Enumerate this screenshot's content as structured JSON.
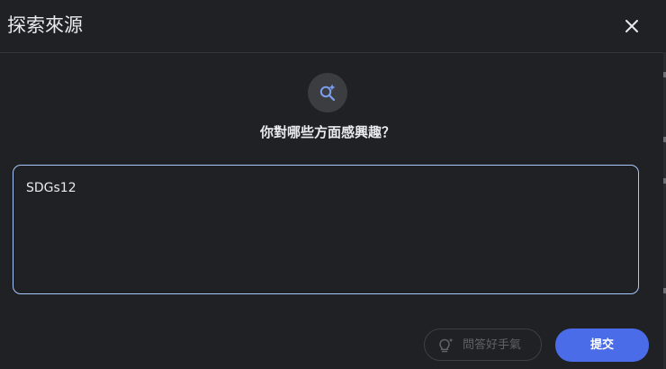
{
  "dialog": {
    "title": "探索來源",
    "close_icon": "close-icon"
  },
  "prompt": {
    "icon": "search-sparkle-icon",
    "question": "你對哪些方面感興趣？"
  },
  "input": {
    "value": "SDGs12"
  },
  "actions": {
    "tips_icon": "lightbulb-sparkle-icon",
    "tips_label": "問答好手氣",
    "submit_label": "提交"
  },
  "colors": {
    "background": "#202124",
    "accent": "#a8c7fa",
    "submit": "#4a6ce8",
    "icon_accent": "#7c9ff0"
  }
}
